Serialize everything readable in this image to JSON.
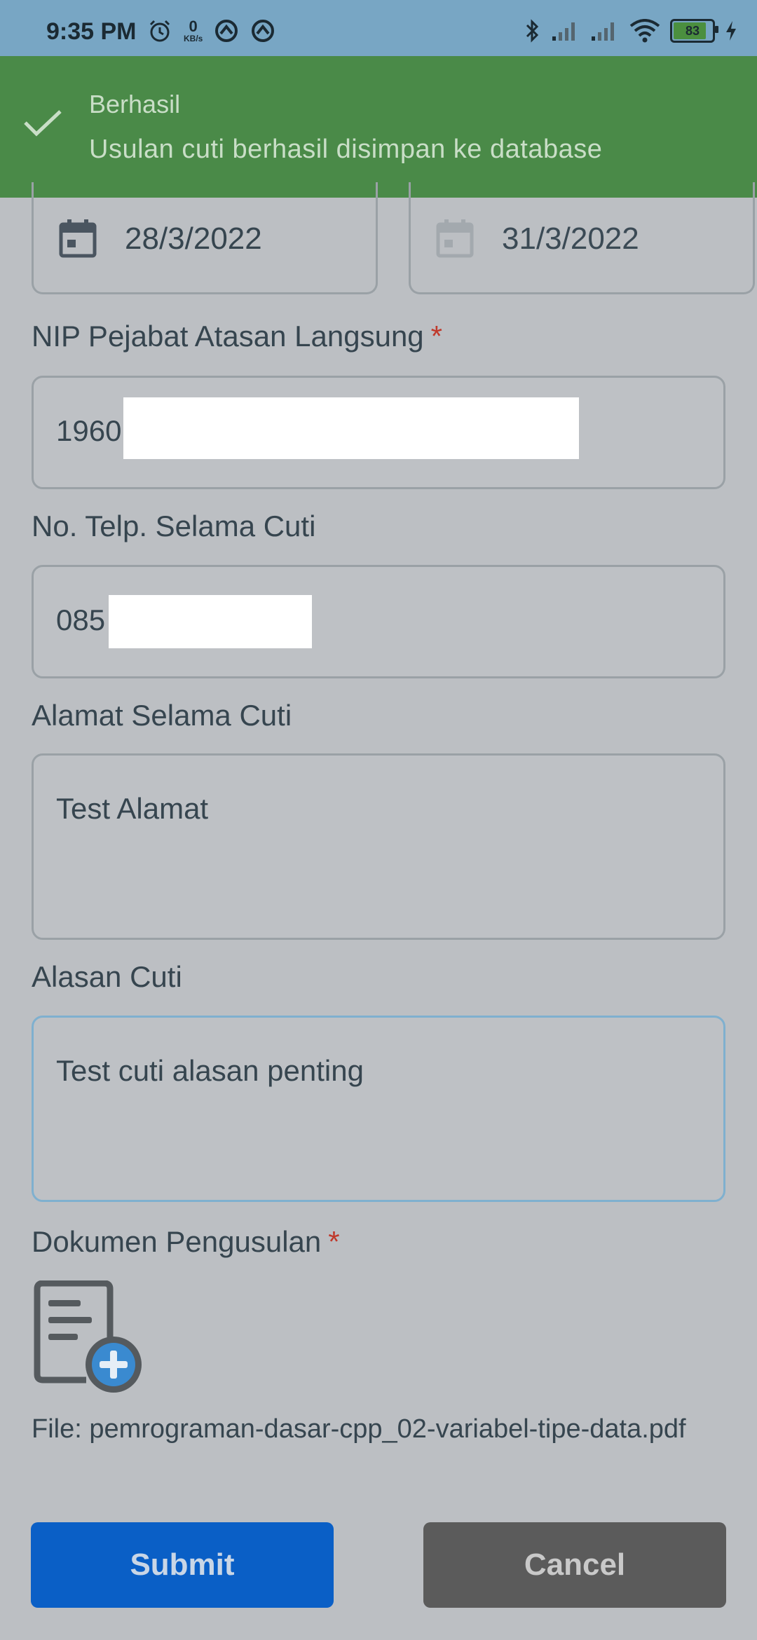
{
  "status_bar": {
    "time": "9:35 PM",
    "net_speed_value": "0",
    "net_speed_unit": "KB/s",
    "battery": "83"
  },
  "toast": {
    "title": "Berhasil",
    "message": "Usulan cuti berhasil disimpan ke database"
  },
  "form": {
    "start_date": "28/3/2022",
    "end_date": "31/3/2022",
    "nip_label": "NIP Pejabat Atasan Langsung",
    "nip_value": "1960",
    "phone_label": "No. Telp. Selama Cuti",
    "phone_value": "085",
    "address_label": "Alamat Selama Cuti",
    "address_value": "Test Alamat",
    "reason_label": "Alasan Cuti",
    "reason_value": "Test cuti alasan penting",
    "document_label": "Dokumen Pengusulan",
    "file_text": "File: pemrograman-dasar-cpp_02-variabel-tipe-data.pdf",
    "required_mark": "*"
  },
  "buttons": {
    "submit": "Submit",
    "cancel": "Cancel"
  },
  "colors": {
    "toast_bg": "#4a8a48",
    "submit_bg": "#0a5fc6",
    "cancel_bg": "#5b5b5b",
    "required": "#c0392b"
  }
}
